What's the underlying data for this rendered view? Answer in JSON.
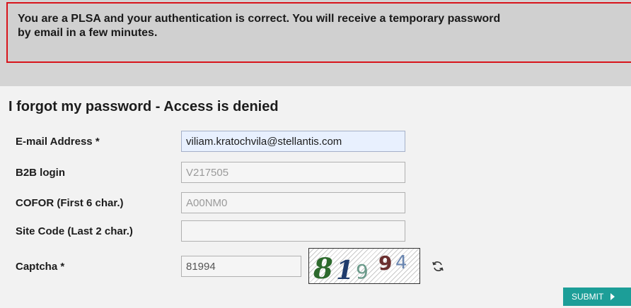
{
  "alert": {
    "line1": "You are a PLSA and your authentication is correct. You will receive a temporary password",
    "line2": "by email in a few minutes."
  },
  "page_title": "I forgot my password - Access is denied",
  "fields": {
    "email": {
      "label": "E-mail Address *",
      "value": "viliam.kratochvila@stellantis.com"
    },
    "b2b_login": {
      "label": "B2B login",
      "value": "V217505"
    },
    "cofor": {
      "label": "COFOR (First 6 char.)",
      "value": "A00NM0"
    },
    "site_code": {
      "label": "Site Code (Last 2 char.)",
      "value": ""
    },
    "captcha": {
      "label": "Captcha *",
      "value": "81994"
    }
  },
  "captcha_image": {
    "digits": [
      "8",
      "1",
      "9",
      "9",
      "4"
    ]
  },
  "refresh_icon": "refresh-icon",
  "submit_label": "SUBMIT",
  "colors": {
    "alert_border": "#d8141b",
    "submit_bg": "#1c9e98",
    "active_field_bg": "#e8f0fe"
  }
}
